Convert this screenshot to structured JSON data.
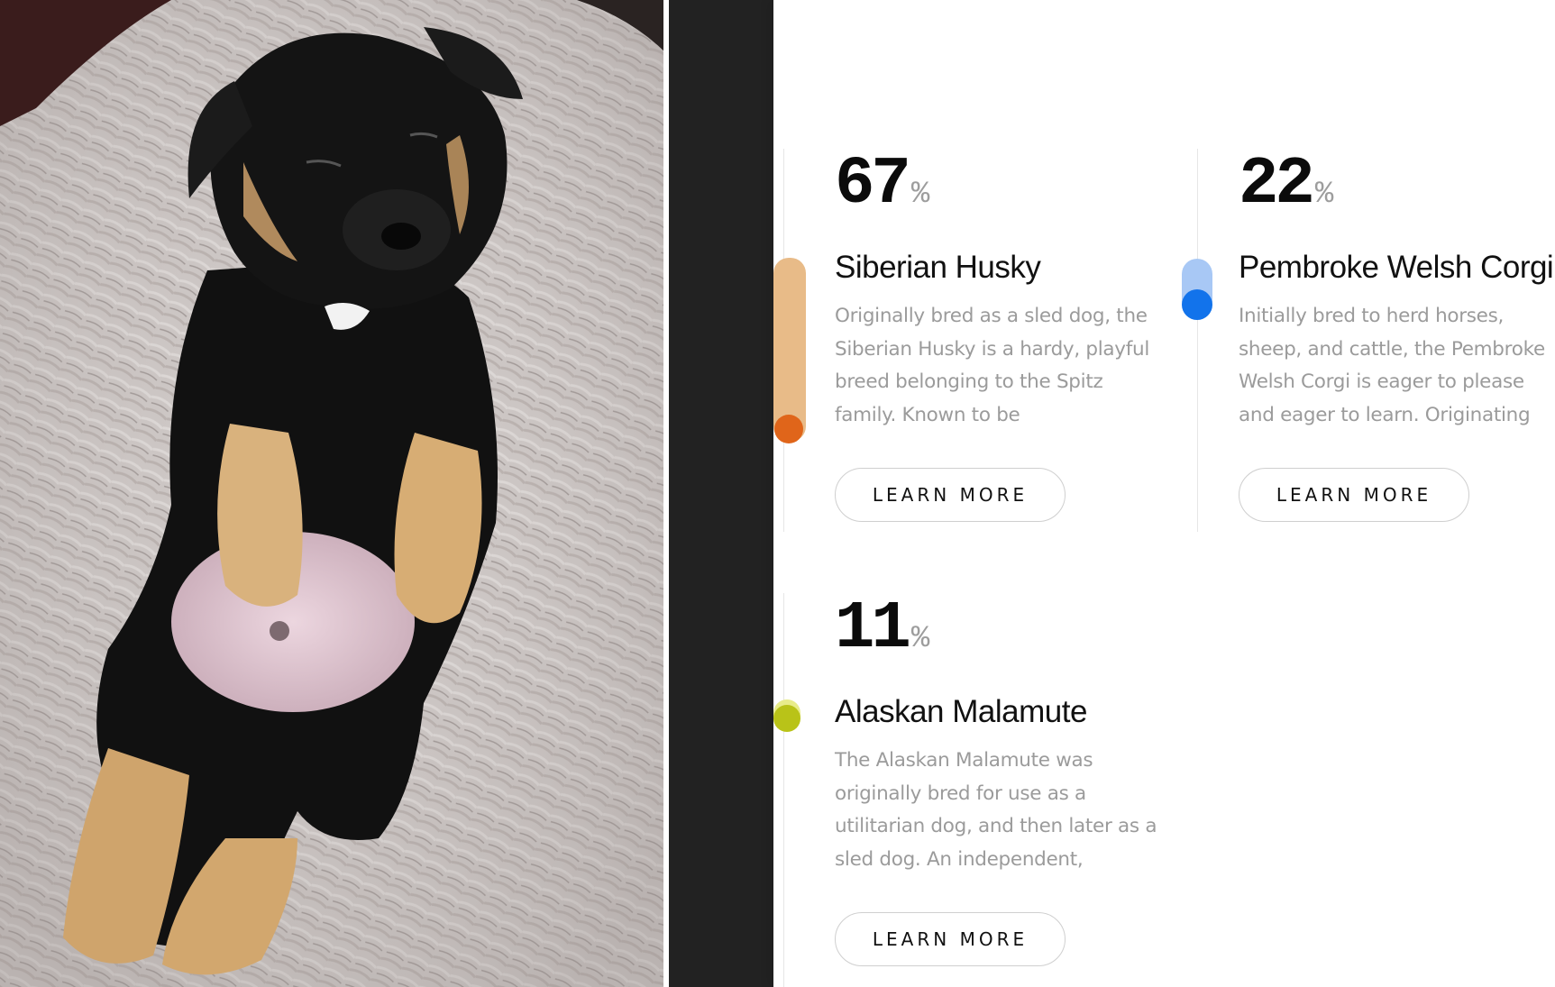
{
  "cards": [
    {
      "percent": "67",
      "percent_sign": "%",
      "breed": "Siberian Husky",
      "description": "Originally bred as a sled dog, the Siberian Husky is a hardy, playful breed belonging to the Spitz family. Known to be",
      "button_label": "LEARN MORE",
      "accent": "#e8bb88",
      "dot_color": "#e0651a",
      "level": 0.67
    },
    {
      "percent": "22",
      "percent_sign": "%",
      "breed": "Pembroke Welsh Corgi",
      "description": "Initially bred to herd horses, sheep, and cattle, the Pembroke Welsh Corgi is eager to please and eager to learn. Originating",
      "button_label": "LEARN MORE",
      "accent": "#a8c8f5",
      "dot_color": "#1273eb",
      "level": 0.22
    },
    {
      "percent": "11",
      "percent_sign": "%",
      "breed": "Alaskan Malamute",
      "description": "The Alaskan Malamute was originally bred for use as a utilitarian dog, and then later as a sled dog. An independent,",
      "button_label": "LEARN MORE",
      "accent": "#e8ec8a",
      "dot_color": "#b9c318",
      "level": 0.11
    }
  ]
}
